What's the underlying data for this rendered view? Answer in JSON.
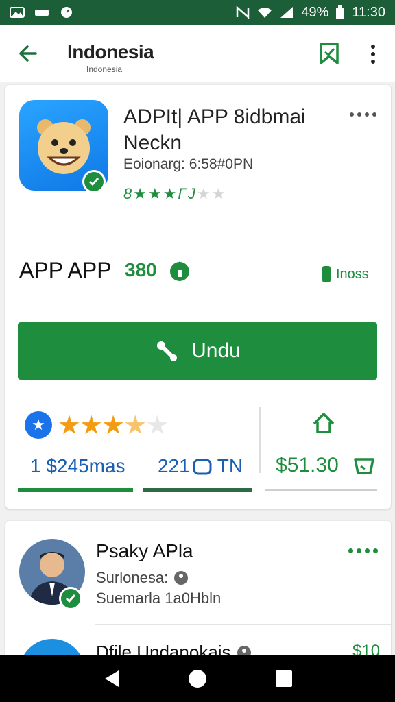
{
  "status_bar": {
    "battery": "49%",
    "time": "11:30"
  },
  "app_bar": {
    "title": "Indonesia",
    "subtitle": "Indonesia"
  },
  "app": {
    "name_line1": "ADPIt| APP 8idbmai",
    "name_line2": "Neckn",
    "developer": "Eoionarg: 6:58#0PN",
    "rating_text": "8★★★ΓJ",
    "rating_dim": "★★"
  },
  "row": {
    "label": "APP APP",
    "count": "380",
    "right_label": "Inoss"
  },
  "download": {
    "label": "Undu"
  },
  "stats": {
    "text1": "1 $245mas",
    "text2": "221",
    "text2_suffix": "TN",
    "price": "$51.30",
    "stars_on": 3,
    "stars_half": 1,
    "stars_off": 1
  },
  "person1": {
    "name": "Psaky APla",
    "line1": "Surlonesa:",
    "line2": "Suemarla 1a0Hbln"
  },
  "person2": {
    "name": "Dfile Undanokais",
    "price": "$10"
  },
  "icons": {
    "back": "arrow-left-icon",
    "bookmark": "bookmark-icon",
    "more": "more-vertical-icon",
    "download": "download-icon",
    "house": "home-icon"
  },
  "colors": {
    "primary": "#1e8e3e",
    "status_bar": "#1b5e38",
    "accent_blue": "#1a73e8"
  }
}
